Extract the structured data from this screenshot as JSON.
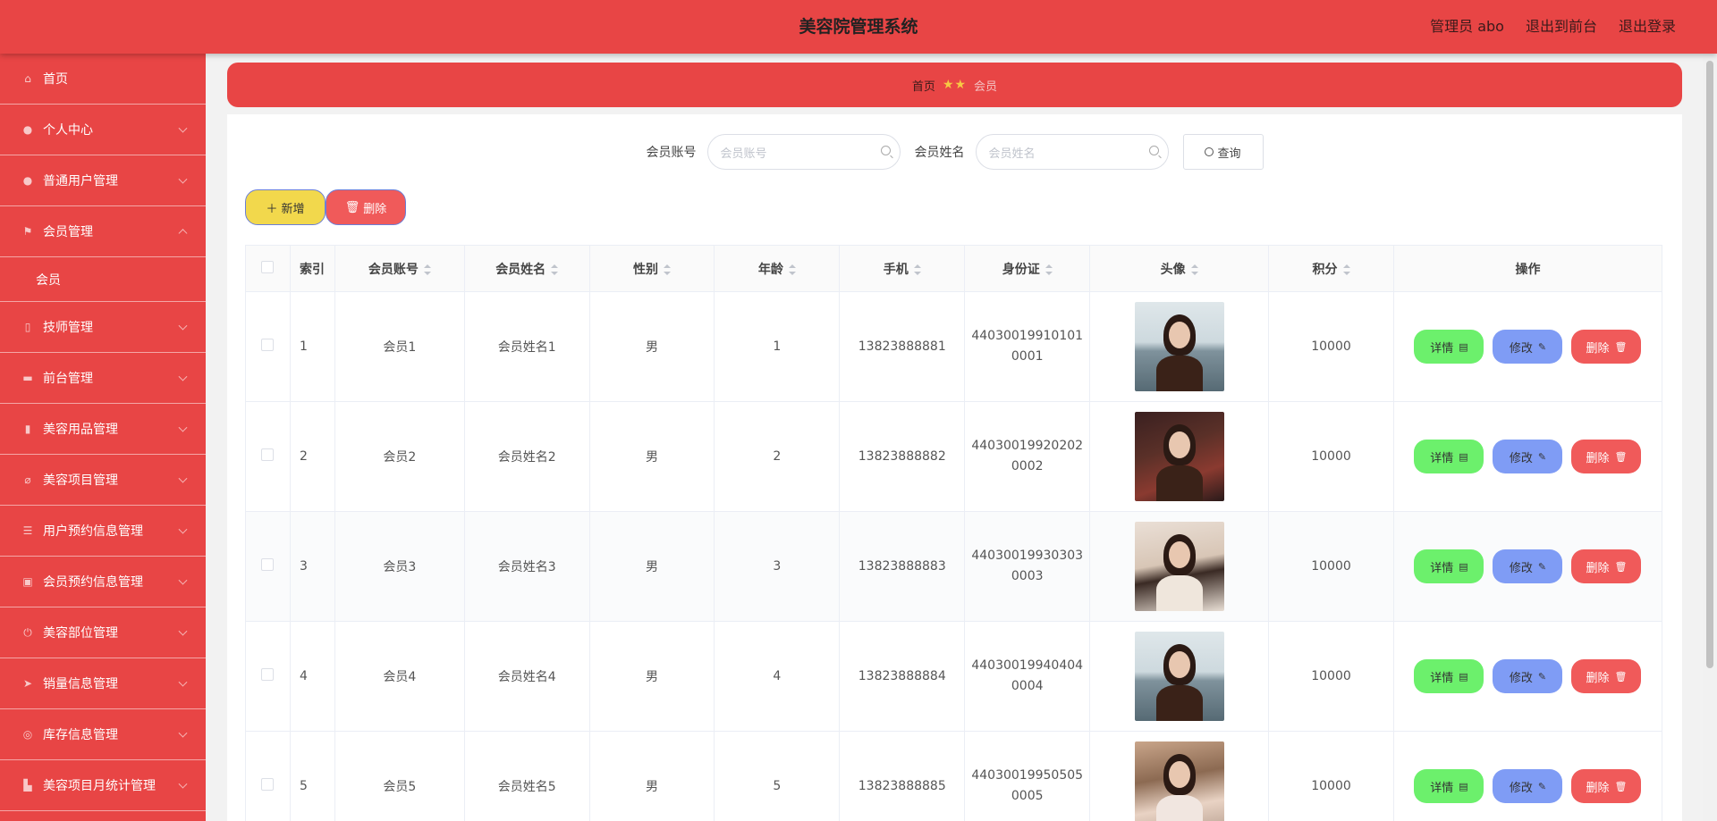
{
  "header": {
    "title": "美容院管理系统",
    "admin": "管理员 abo",
    "back_to_front": "退出到前台",
    "logout": "退出登录"
  },
  "sidebar": {
    "items": [
      {
        "label": "首页",
        "icon": "home-icon"
      },
      {
        "label": "个人中心",
        "icon": "user-icon"
      },
      {
        "label": "普通用户管理",
        "icon": "user-icon"
      },
      {
        "label": "会员管理",
        "icon": "flag-icon"
      },
      {
        "label": "技师管理",
        "icon": "phone-icon"
      },
      {
        "label": "前台管理",
        "icon": "briefcase-icon"
      },
      {
        "label": "美容用品管理",
        "icon": "chart-icon"
      },
      {
        "label": "美容项目管理",
        "icon": "bell-off-icon"
      },
      {
        "label": "用户预约信息管理",
        "icon": "list-icon"
      },
      {
        "label": "会员预约信息管理",
        "icon": "clipboard-icon"
      },
      {
        "label": "美容部位管理",
        "icon": "power-icon"
      },
      {
        "label": "销量信息管理",
        "icon": "send-icon"
      },
      {
        "label": "库存信息管理",
        "icon": "compass-icon"
      },
      {
        "label": "美容项目月统计管理",
        "icon": "factory-icon"
      }
    ],
    "sub_member": "会员"
  },
  "breadcrumb": {
    "home": "首页",
    "current": "会员"
  },
  "search": {
    "account_label": "会员账号",
    "account_placeholder": "会员账号",
    "name_label": "会员姓名",
    "name_placeholder": "会员姓名",
    "query_label": "查询"
  },
  "actions": {
    "add_label": "新增",
    "delete_label": "删除"
  },
  "table": {
    "headers": [
      "索引",
      "会员账号",
      "会员姓名",
      "性别",
      "年龄",
      "手机",
      "身份证",
      "头像",
      "积分",
      "操作"
    ],
    "rows": [
      {
        "index": "1",
        "account": "会员1",
        "name": "会员姓名1",
        "gender": "男",
        "age": "1",
        "phone": "13823888881",
        "id_line1": "44030019910101",
        "id_line2": "0001",
        "points": "10000"
      },
      {
        "index": "2",
        "account": "会员2",
        "name": "会员姓名2",
        "gender": "男",
        "age": "2",
        "phone": "13823888882",
        "id_line1": "44030019920202",
        "id_line2": "0002",
        "points": "10000"
      },
      {
        "index": "3",
        "account": "会员3",
        "name": "会员姓名3",
        "gender": "男",
        "age": "3",
        "phone": "13823888883",
        "id_line1": "44030019930303",
        "id_line2": "0003",
        "points": "10000"
      },
      {
        "index": "4",
        "account": "会员4",
        "name": "会员姓名4",
        "gender": "男",
        "age": "4",
        "phone": "13823888884",
        "id_line1": "44030019940404",
        "id_line2": "0004",
        "points": "10000"
      },
      {
        "index": "5",
        "account": "会员5",
        "name": "会员姓名5",
        "gender": "男",
        "age": "5",
        "phone": "13823888885",
        "id_line1": "44030019950505",
        "id_line2": "0005",
        "points": "10000"
      }
    ],
    "op_detail": "详情",
    "op_edit": "修改",
    "op_delete": "删除"
  },
  "colors": {
    "primary": "#e84545",
    "add_button": "#f2d84c",
    "detail_button": "#6cf06c",
    "edit_button": "#7f9cf5",
    "delete_button": "#f05a5a"
  }
}
